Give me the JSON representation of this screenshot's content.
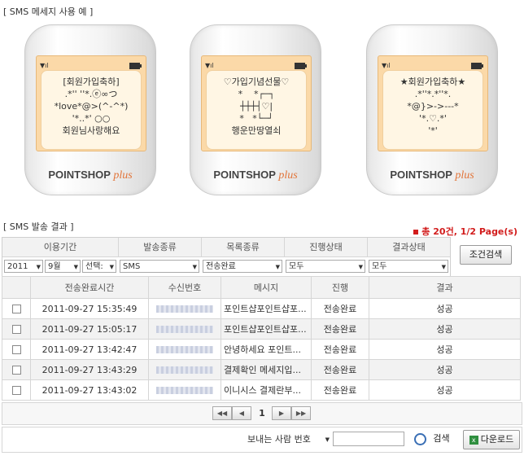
{
  "examples_title": "[ SMS 메세지 사용 예 ]",
  "brand_name": "POINTSHOP",
  "brand_suffix": "plus",
  "phones": [
    {
      "lines": [
        "[회원가입축하]",
        ".*'' ''*.ⓔ∞つ",
        "*love*@>(^-^*)",
        "'*..*' ○○",
        "회원님사랑해요"
      ]
    },
    {
      "lines": [
        "♡가입기념선물♡",
        "*    *┌─┐",
        "┼┼┼┤♡|",
        "*   *└─┘",
        "행운만땅열쇠"
      ]
    },
    {
      "lines": [
        "★회원가입축하★",
        ".*''*.*''*.",
        "*@}>->---*",
        "'*.♡.*'",
        "'*'"
      ]
    }
  ],
  "results_title": "[ SMS 발송 결과 ]",
  "total": {
    "prefix": "총",
    "count": "20건,",
    "pages": "1/2 Page(s)"
  },
  "filters": {
    "headers": [
      "이용기간",
      "발송종류",
      "목록종류",
      "진행상태",
      "결과상태"
    ],
    "year": "2011",
    "month": "9월",
    "day": "선택:",
    "send_type": "SMS",
    "list_type": "전송완료",
    "progress": "모두",
    "result": "모두",
    "search_button": "조건검색"
  },
  "table": {
    "headers": [
      "전송완료시간",
      "수신번호",
      "메시지",
      "진행",
      "결과"
    ],
    "rows": [
      {
        "time": "2011-09-27 15:35:49",
        "message": "포인트샵포인트샵포...",
        "progress": "전송완료",
        "result": "성공"
      },
      {
        "time": "2011-09-27 15:05:17",
        "message": "포인트샵포인트샵포...",
        "progress": "전송완료",
        "result": "성공"
      },
      {
        "time": "2011-09-27 13:42:47",
        "message": "안녕하세요 포인트...",
        "progress": "전송완료",
        "result": "성공"
      },
      {
        "time": "2011-09-27 13:43:29",
        "message": "결제확인 메세지입...",
        "progress": "전송완료",
        "result": "성공"
      },
      {
        "time": "2011-09-27 13:43:02",
        "message": "이니시스 결제란부...",
        "progress": "전송완료",
        "result": "성공"
      }
    ]
  },
  "pager": {
    "current": "1",
    "first": "◀◀",
    "prev": "◀",
    "next": "▶",
    "last": "▶▶"
  },
  "bottom": {
    "sender_select": "보내는 사람 번호",
    "sender_input": "",
    "search_button": "검색",
    "download_button": "다운로드"
  },
  "colors": {
    "accent_red": "#d21c1c",
    "phone_screen": "#fbd9a8",
    "brand_plus": "#e2753a"
  }
}
